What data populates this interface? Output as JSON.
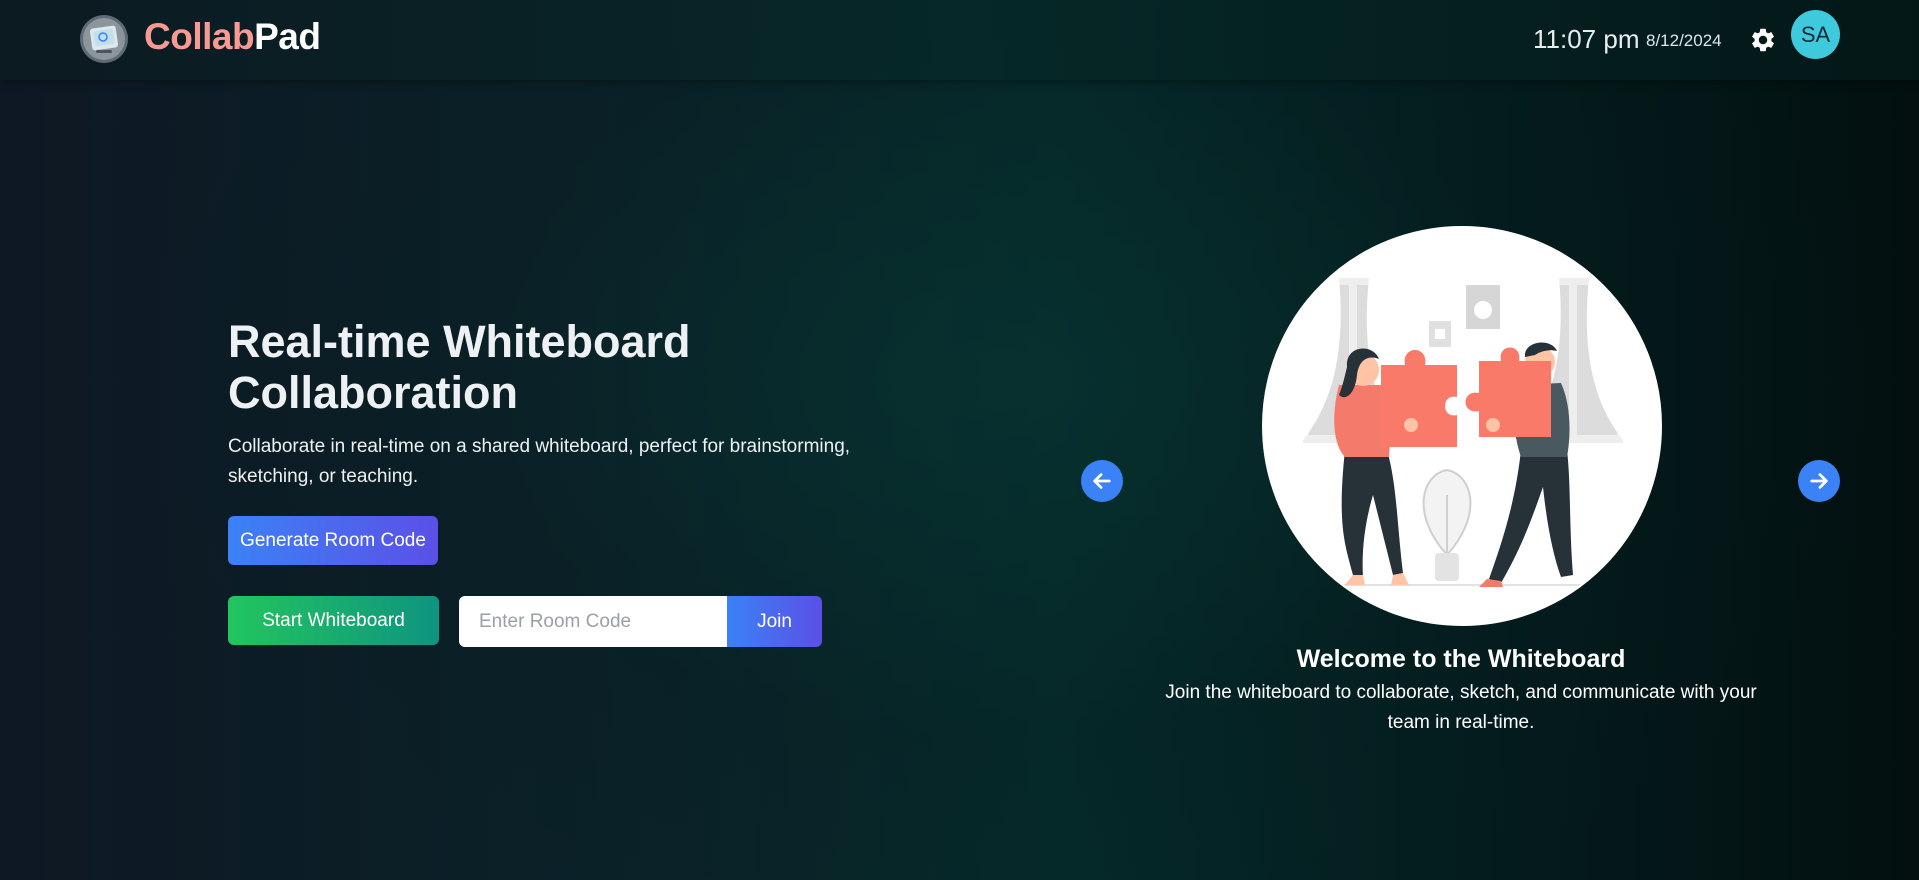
{
  "header": {
    "brand_part1": "Collab",
    "brand_part2": "Pad",
    "time": "11:07 pm",
    "date": "8/12/2024",
    "avatar_initials": "SA",
    "logo_icon": "whiteboard-logo-icon",
    "settings_icon": "gear-icon"
  },
  "hero": {
    "title": "Real-time Whiteboard Collaboration",
    "subtitle": "Collaborate in real-time on a shared whiteboard, perfect for brainstorming, sketching, or teaching.",
    "generate_label": "Generate Room Code",
    "start_label": "Start Whiteboard",
    "room_placeholder": "Enter Room Code",
    "join_label": "Join"
  },
  "carousel": {
    "slide_title": "Welcome to the Whiteboard",
    "slide_text": "Join the whiteboard to collaborate, sketch, and communicate with your team in real-time.",
    "prev_icon": "arrow-left-icon",
    "next_icon": "arrow-right-icon",
    "illustration": "puzzle-collaboration-illustration"
  },
  "colors": {
    "brand_accent": "#f79a94",
    "primary_blue": "#3b82f6",
    "primary_violet": "#5b50e6",
    "green": "#22c55e",
    "teal": "#0f9480",
    "avatar_bg": "#3fc9dd",
    "puzzle": "#fa7a6a"
  }
}
